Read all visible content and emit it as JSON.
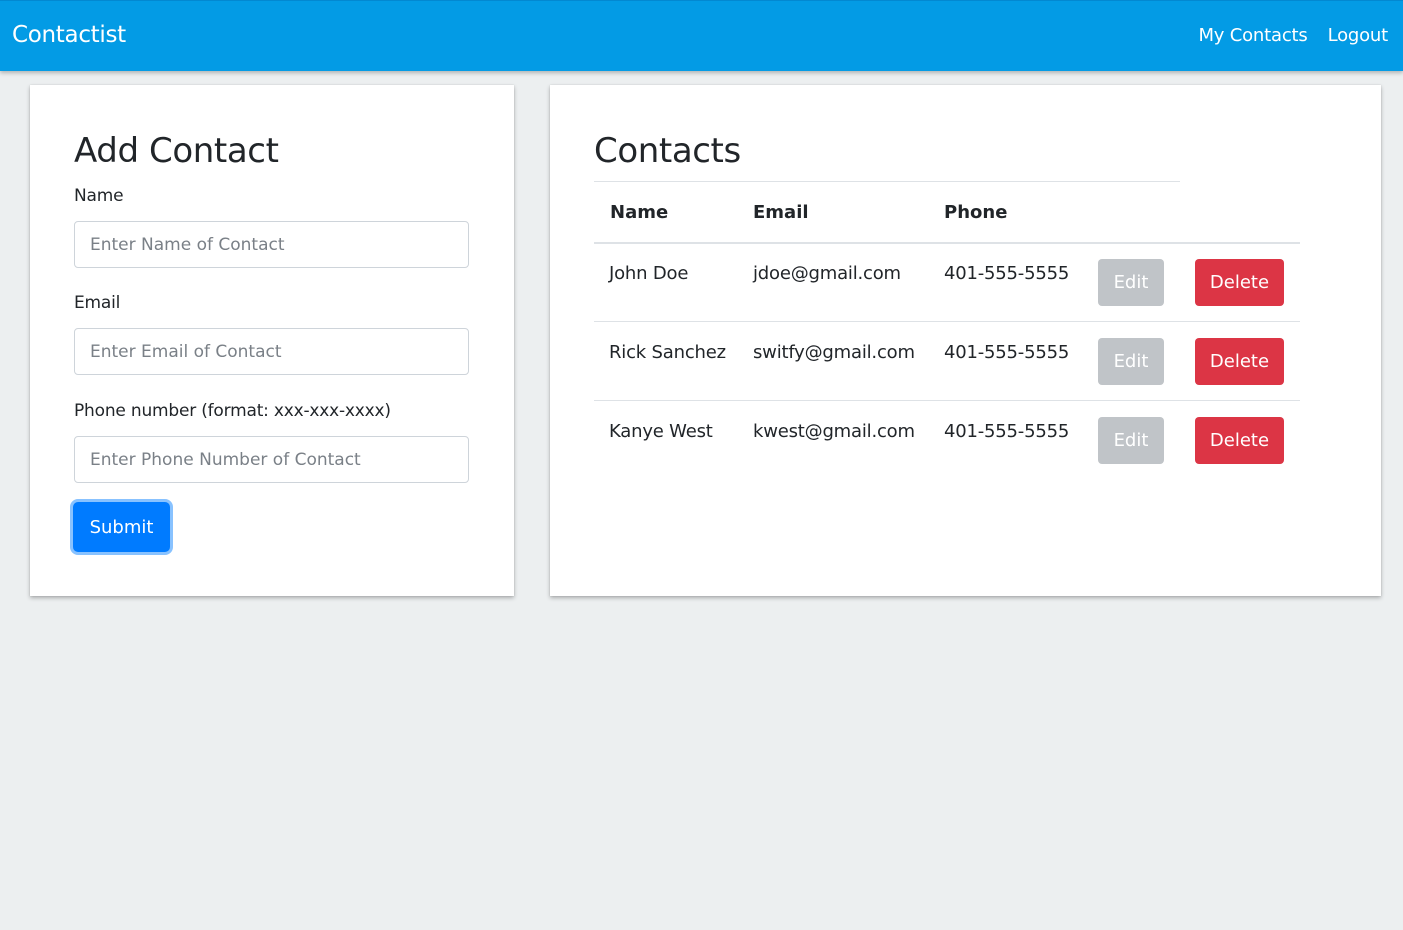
{
  "navbar": {
    "brand": "Contactist",
    "links": [
      "My Contacts",
      "Logout"
    ]
  },
  "add_contact": {
    "title": "Add Contact",
    "name_label": "Name",
    "name_placeholder": "Enter Name of Contact",
    "email_label": "Email",
    "email_placeholder": "Enter Email of Contact",
    "phone_label": "Phone number (format: xxx-xxx-xxxx)",
    "phone_placeholder": "Enter Phone Number of Contact",
    "submit_label": "Submit"
  },
  "contacts": {
    "title": "Contacts",
    "columns": [
      "Name",
      "Email",
      "Phone"
    ],
    "rows": [
      {
        "name": "John Doe",
        "email": "jdoe@gmail.com",
        "phone": "401-555-5555",
        "edit": "Edit",
        "delete": "Delete"
      },
      {
        "name": "Rick Sanchez",
        "email": "switfy@gmail.com",
        "phone": "401-555-5555",
        "edit": "Edit",
        "delete": "Delete"
      },
      {
        "name": "Kanye West",
        "email": "kwest@gmail.com",
        "phone": "401-555-5555",
        "edit": "Edit",
        "delete": "Delete"
      }
    ]
  },
  "colors": {
    "navbar": "#039be5",
    "primary": "#007bff",
    "danger": "#dc3545",
    "edit_disabled": "#c0c4c8",
    "background": "#eceff0"
  }
}
